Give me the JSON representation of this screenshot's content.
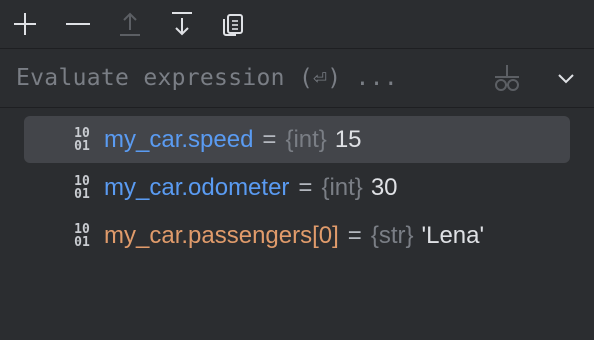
{
  "toolbar": {
    "buttons": [
      {
        "icon": "plus-icon",
        "label": "Add watch"
      },
      {
        "icon": "minus-icon",
        "label": "Remove watch"
      },
      {
        "icon": "move-up-icon",
        "label": "Move up"
      },
      {
        "icon": "move-down-icon",
        "label": "Move down"
      },
      {
        "icon": "copy-icon",
        "label": "Copy"
      }
    ]
  },
  "evaluate": {
    "placeholder": "Evaluate expression (⏎) ...",
    "value": "",
    "watch_icon": "add-watch-glasses-icon",
    "expand_icon": "chevron-down-icon"
  },
  "variables": [
    {
      "type_icon": "10\n01",
      "name": "my_car.speed",
      "equals": "=",
      "type": "{int}",
      "value": "15",
      "selected": true,
      "name_color": "#5a9bf2"
    },
    {
      "type_icon": "10\n01",
      "name": "my_car.odometer",
      "equals": "=",
      "type": "{int}",
      "value": "30",
      "selected": false,
      "name_color": "#5a9bf2"
    },
    {
      "type_icon": "10\n01",
      "name": "my_car.passengers[0]",
      "equals": "=",
      "type": "{str}",
      "value": "'Lena'",
      "selected": false,
      "name_color": "#e09b6b"
    }
  ],
  "colors": {
    "background": "#2b2d30",
    "selection": "#43454a",
    "name_blue": "#5a9bf2",
    "name_orange": "#e09b6b",
    "muted": "#7a7e85",
    "value": "#dfe1e5"
  }
}
